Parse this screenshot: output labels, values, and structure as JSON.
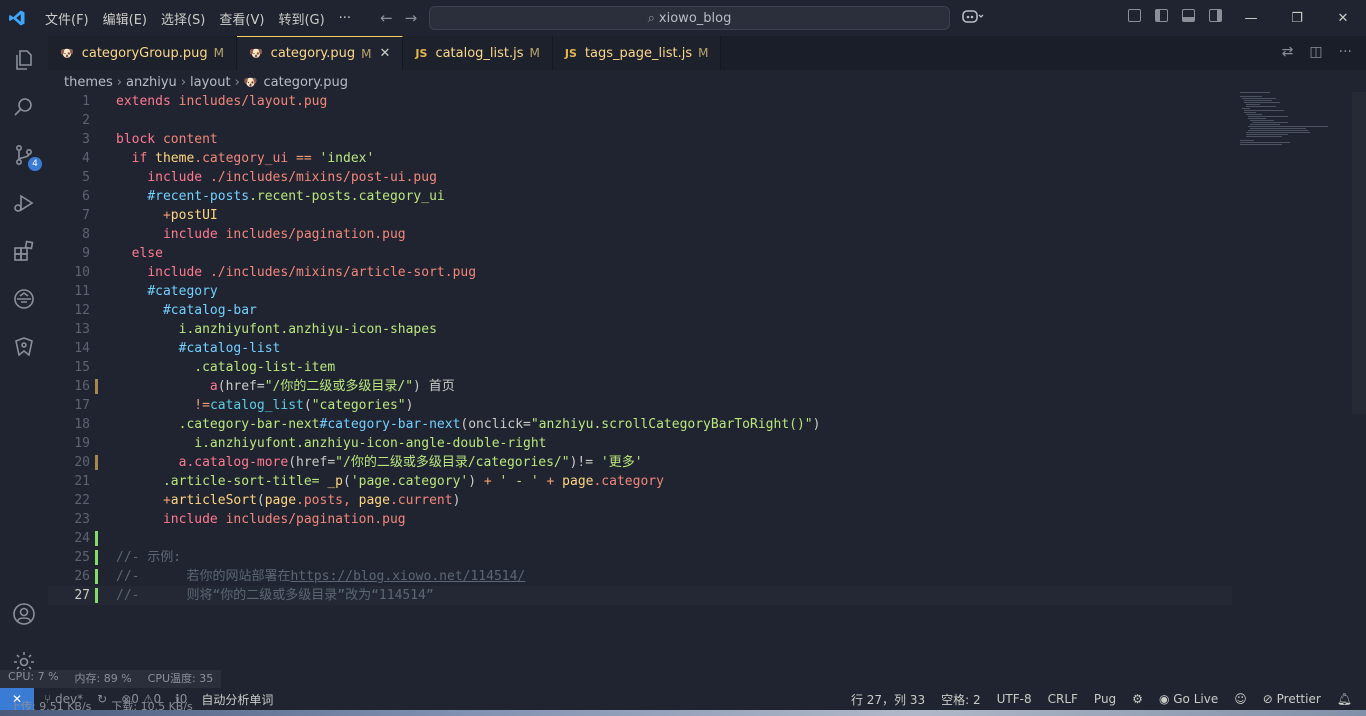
{
  "menu": [
    "文件(F)",
    "编辑(E)",
    "选择(S)",
    "查看(V)",
    "转到(G)",
    "···"
  ],
  "search": {
    "text": "xiowo_blog"
  },
  "tabs": [
    {
      "label": "categoryGroup.pug",
      "icon": "pug",
      "modified": "M",
      "active": false
    },
    {
      "label": "category.pug",
      "icon": "pug",
      "modified": "M",
      "active": true
    },
    {
      "label": "catalog_list.js",
      "icon": "JS",
      "modified": "M",
      "active": false
    },
    {
      "label": "tags_page_list.js",
      "icon": "JS",
      "modified": "M",
      "active": false
    }
  ],
  "breadcrumb": [
    "themes",
    "anzhiyu",
    "layout",
    "category.pug"
  ],
  "activity_badge": "4",
  "lines": [
    {
      "n": "1"
    },
    {
      "n": "2"
    },
    {
      "n": "3"
    },
    {
      "n": "4"
    },
    {
      "n": "5"
    },
    {
      "n": "6"
    },
    {
      "n": "7"
    },
    {
      "n": "8"
    },
    {
      "n": "9"
    },
    {
      "n": "10"
    },
    {
      "n": "11"
    },
    {
      "n": "12"
    },
    {
      "n": "13"
    },
    {
      "n": "14"
    },
    {
      "n": "15"
    },
    {
      "n": "16"
    },
    {
      "n": "17"
    },
    {
      "n": "18"
    },
    {
      "n": "19"
    },
    {
      "n": "20"
    },
    {
      "n": "21"
    },
    {
      "n": "22"
    },
    {
      "n": "23"
    },
    {
      "n": "24"
    },
    {
      "n": "25"
    },
    {
      "n": "26"
    },
    {
      "n": "27"
    }
  ],
  "code": {
    "l1a": "extends",
    "l1b": "includes/layout.pug",
    "l3a": "block",
    "l3b": "content",
    "l4a": "if",
    "l4b": "theme",
    "l4c": ".category_ui",
    "l4d": "==",
    "l4e": "'index'",
    "l5a": "include",
    "l5b": "./includes/mixins/post-ui.pug",
    "l6a": "#recent-posts",
    "l6b": ".recent-posts.category_ui",
    "l7a": "+",
    "l7b": "postUI",
    "l8a": "include",
    "l8b": "includes/pagination.pug",
    "l9a": "else",
    "l10a": "include",
    "l10b": "./includes/mixins/article-sort.pug",
    "l11a": "#category",
    "l12a": "#catalog-bar",
    "l13a": "i.anzhiyufont.anzhiyu-icon-shapes",
    "l14a": "#catalog-list",
    "l15a": ".catalog-list-item",
    "l16a": "a",
    "l16b": "(href=",
    "l16c": "\"/你的二级或多级目录/\"",
    "l16d": ")",
    "l16e": "首页",
    "l17a": "!=",
    "l17b": "catalog_list",
    "l17c": "(",
    "l17d": "\"categories\"",
    "l17e": ")",
    "l18a": ".category-bar-next",
    "l18b": "#category-bar-next",
    "l18c": "(onclick=",
    "l18d": "\"anzhiyu.scrollCategoryBarToRight()\"",
    "l18e": ")",
    "l19a": "i.anzhiyufont.anzhiyu-icon-angle-double-right",
    "l20a": "a.catalog-more",
    "l20b": "(href=",
    "l20c": "\"/你的二级或多级目录/categories/\"",
    "l20d": ")!=",
    "l20e": "'更多'",
    "l21a": ".article-sort-title=",
    "l21b": "_p",
    "l21c": "(",
    "l21d": "'page.category'",
    "l21e": ")",
    "l21f": "+",
    "l21g": "' - '",
    "l21h": "+",
    "l21i": "page",
    "l21j": ".category",
    "l22a": "+",
    "l22b": "articleSort",
    "l22c": "(",
    "l22d": "page",
    "l22e": ".posts,",
    "l22f": "page",
    "l22g": ".current",
    "l22h": ")",
    "l23a": "include",
    "l23b": "includes/pagination.pug",
    "l25a": "//- 示例:",
    "l26a": "//-      若你的网站部署在",
    "l26b": "https://blog.xiowo.net/114514/",
    "l27a": "//-      则将“你的二级或多级目录”改为“114514”"
  },
  "perf": {
    "cpu": "CPU: 7 %",
    "mem": "内存: 89 %",
    "temp": "CPU温度: 35"
  },
  "status": {
    "branch": "dev*",
    "errors": "0",
    "warnings": "0",
    "info": "0",
    "auto": "自动分析单词",
    "position": "行 27，列 33",
    "spaces": "空格: 2",
    "encoding": "UTF-8",
    "eol": "CRLF",
    "lang": "Pug",
    "golive": "Go Live",
    "prettier": "Prettier"
  },
  "net": {
    "up": "上传: 9.51 KB/s",
    "down": "下载: 10.5 KB/s"
  },
  "colors": {
    "accent": "#3a7bd5",
    "tab_active_border": "#ffcc66",
    "background": "#1f2430"
  }
}
